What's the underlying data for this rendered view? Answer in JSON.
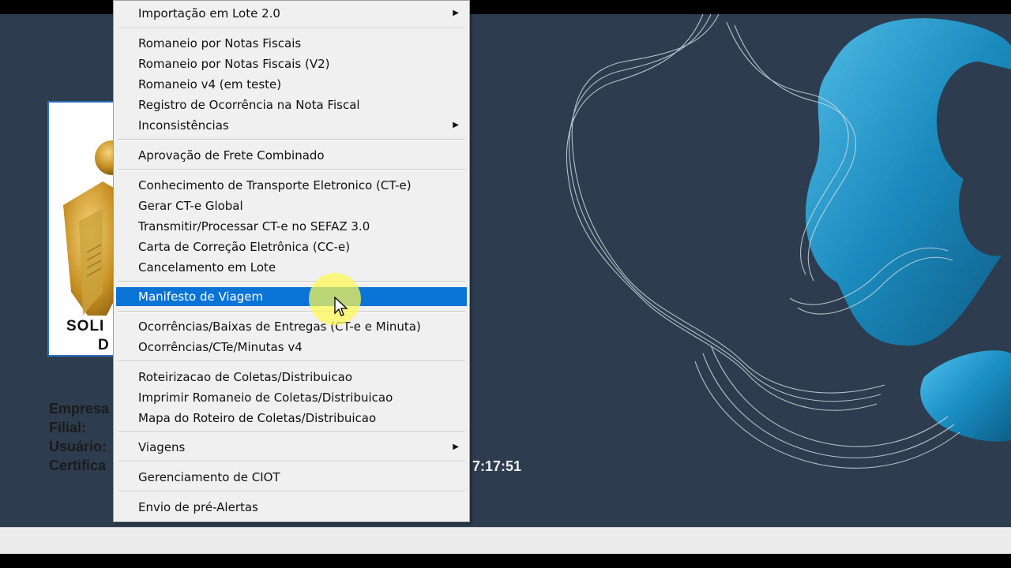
{
  "menu": {
    "items": [
      {
        "label": "Importação em Lote 2.0",
        "submenu": true
      },
      {
        "label": "Romaneio por Notas Fiscais"
      },
      {
        "label": "Romaneio por Notas Fiscais (V2)"
      },
      {
        "label": "Romaneio v4 (em teste)"
      },
      {
        "label": "Registro de Ocorrência na Nota Fiscal"
      },
      {
        "label": "Inconsistências",
        "submenu": true
      },
      {
        "label": "Aprovação de Frete Combinado"
      },
      {
        "label": "Conhecimento de Transporte Eletronico (CT-e)"
      },
      {
        "label": "Gerar CT-e Global"
      },
      {
        "label": "Transmitir/Processar CT-e no SEFAZ 3.0"
      },
      {
        "label": "Carta de Correção Eletrônica (CC-e)"
      },
      {
        "label": "Cancelamento em Lote"
      },
      {
        "label": "Manifesto de Viagem",
        "selected": true
      },
      {
        "label": "Ocorrências/Baixas de Entregas (CT-e e Minuta)"
      },
      {
        "label": "Ocorrências/CTe/Minutas v4"
      },
      {
        "label": "Roteirizacao de Coletas/Distribuicao"
      },
      {
        "label": "Imprimir Romaneio de Coletas/Distribuicao"
      },
      {
        "label": "Mapa do Roteiro de Coletas/Distribuicao"
      },
      {
        "label": "Viagens",
        "submenu": true
      },
      {
        "label": "Gerenciamento de CIOT"
      },
      {
        "label": "Envio de pré-Alertas"
      }
    ],
    "arrow_glyph": "▶",
    "selected_color": "#0a74d6"
  },
  "logo": {
    "line1": "SOLI",
    "line2": "D"
  },
  "info": {
    "empresa_label": "Empresa",
    "filial_label": "Filial:",
    "usuario_label": "Usuário:",
    "certificado_label": "Certifica",
    "clock": "7:17:51"
  },
  "colors": {
    "desktop_bg": "#2d3d4f",
    "art_blue": "#1aa3d9"
  }
}
